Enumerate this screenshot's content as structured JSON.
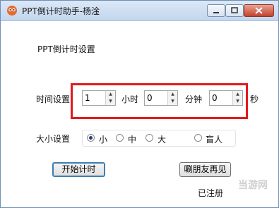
{
  "window": {
    "title": "PPT倒计时助手-杨淦"
  },
  "section_title": "PPT倒计时设置",
  "time": {
    "label": "时间设置",
    "hours": "1",
    "hours_unit": "小时",
    "minutes": "0",
    "minutes_unit": "分钟",
    "seconds": "0",
    "seconds_unit": "秒"
  },
  "size": {
    "label": "大小设置",
    "options": [
      "小",
      "中",
      "大",
      "盲人"
    ],
    "selected": "小"
  },
  "buttons": {
    "start": "开始计时",
    "share": "唰朋友再见"
  },
  "status": "已注册",
  "watermark": "当游网",
  "colors": {
    "highlight": "#e3191c",
    "close": "#c4412b"
  }
}
